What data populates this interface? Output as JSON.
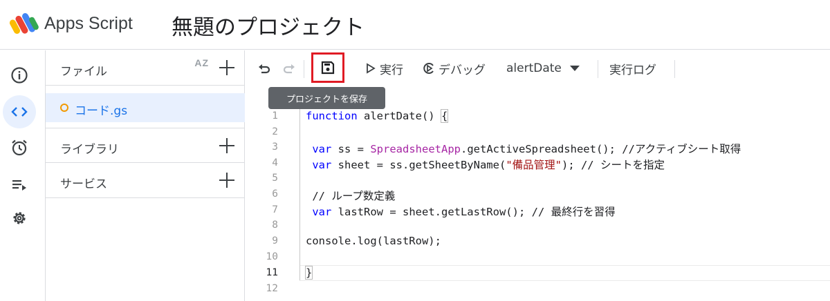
{
  "header": {
    "app_name": "Apps Script",
    "project_title": "無題のプロジェクト"
  },
  "rail": {
    "items": [
      {
        "icon": "info-icon"
      },
      {
        "icon": "code-icon",
        "active": true
      },
      {
        "icon": "alarm-clock-icon"
      },
      {
        "icon": "executions-icon"
      },
      {
        "icon": "gear-icon"
      }
    ]
  },
  "files_panel": {
    "files_label": "ファイル",
    "sort_icon_text": "AZ",
    "file_name": "コード.gs",
    "libraries_label": "ライブラリ",
    "services_label": "サービス"
  },
  "toolbar": {
    "run_label": "実行",
    "debug_label": "デバッグ",
    "function_name": "alertDate",
    "log_label": "実行ログ",
    "save_tooltip": "プロジェクトを保存"
  },
  "editor": {
    "lines": [
      {
        "num": "1",
        "code": "function alertDate() {"
      },
      {
        "num": "2",
        "code": ""
      },
      {
        "num": "3",
        "code": " var ss = SpreadsheetApp.getActiveSpreadsheet(); //アクティブシート取得"
      },
      {
        "num": "4",
        "code": " var sheet = ss.getSheetByName(\"備品管理\"); // シートを指定"
      },
      {
        "num": "5",
        "code": ""
      },
      {
        "num": "6",
        "code": " // ループ数定義"
      },
      {
        "num": "7",
        "code": " var lastRow = sheet.getLastRow(); // 最終行を習得"
      },
      {
        "num": "8",
        "code": ""
      },
      {
        "num": "9",
        "code": "console.log(lastRow);"
      },
      {
        "num": "10",
        "code": ""
      },
      {
        "num": "11",
        "code": "}"
      },
      {
        "num": "12",
        "code": ""
      }
    ],
    "current_line": "11"
  },
  "colors": {
    "accent": "#1a73e8",
    "active_bg": "#e8f0fe",
    "highlight_box": "#e01b24",
    "keyword": "#0000ff",
    "class_name": "#a626a4",
    "string": "#a31515"
  }
}
